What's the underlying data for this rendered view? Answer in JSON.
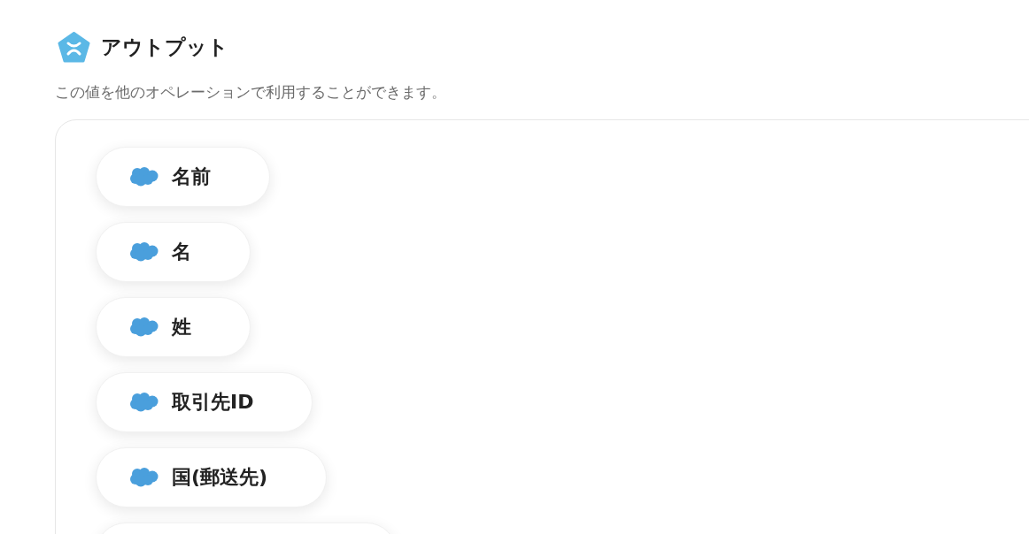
{
  "header": {
    "title": "アウトプット",
    "description": "この値を他のオペレーションで利用することができます。"
  },
  "outputs": [
    {
      "kind": "chip",
      "label": "名前"
    },
    {
      "kind": "chip",
      "label": "名"
    },
    {
      "kind": "chip",
      "label": "姓"
    },
    {
      "kind": "chip",
      "label": "取引先ID"
    },
    {
      "kind": "chip",
      "label": "国(郵送先)"
    },
    {
      "kind": "cut"
    }
  ]
}
